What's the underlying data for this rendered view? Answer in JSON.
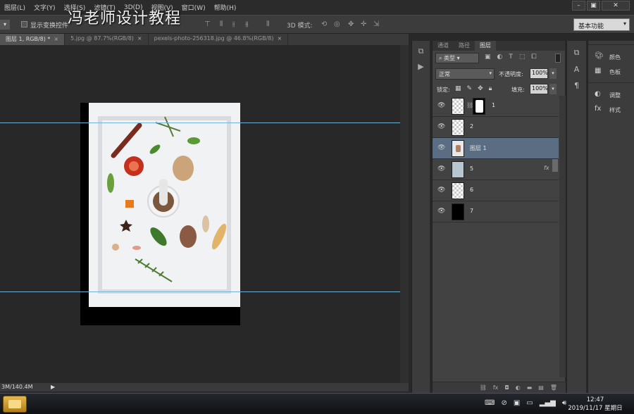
{
  "menubar": {
    "items": [
      "图层(L)",
      "文字(Y)",
      "选择(S)",
      "滤镜(T)",
      "3D(D)",
      "视图(V)",
      "窗口(W)",
      "帮助(H)"
    ],
    "watermark": "冯老师设计教程"
  },
  "options_bar": {
    "show_transform_label": "显示变换控件",
    "mode_3d_label": "3D 模式:",
    "workspace": "基本功能"
  },
  "doc_tabs": [
    {
      "label": "图层 1, RGB/8) *",
      "active": true
    },
    {
      "label": "5.jpg @ 87.7%(RGB/8)",
      "active": false
    },
    {
      "label": "pexels-photo-256318.jpg @ 46.8%(RGB/8)",
      "active": false
    }
  ],
  "statusbar": {
    "doc_size": "3M/140.4M"
  },
  "layers_panel": {
    "tabs": [
      "通道",
      "路径",
      "图层"
    ],
    "active_tab": "图层",
    "filter_label": "类型",
    "blend_mode": "正常",
    "opacity_label": "不透明度:",
    "opacity_value": "100%",
    "lock_label": "锁定:",
    "fill_label": "填充:",
    "fill_value": "100%",
    "layers": [
      {
        "name": "1",
        "thumb": "checker",
        "has_mask": true,
        "fx": false,
        "selected": false
      },
      {
        "name": "2",
        "thumb": "checker",
        "has_mask": false,
        "fx": false,
        "selected": false
      },
      {
        "name": "图层 1",
        "thumb": "photo",
        "has_mask": false,
        "fx": false,
        "selected": true
      },
      {
        "name": "5",
        "thumb": "blue",
        "has_mask": false,
        "fx": true,
        "selected": false
      },
      {
        "name": "6",
        "thumb": "checker",
        "has_mask": false,
        "fx": false,
        "selected": false
      },
      {
        "name": "7",
        "thumb": "black",
        "has_mask": false,
        "fx": false,
        "selected": false
      }
    ]
  },
  "right_panel": {
    "items": [
      {
        "label": "颜色",
        "icon": "palette-icon"
      },
      {
        "label": "色板",
        "icon": "swatches-icon"
      },
      {
        "label": "调整",
        "icon": "adjustments-icon"
      },
      {
        "label": "样式",
        "icon": "styles-icon"
      }
    ]
  },
  "taskbar": {
    "time": "12:47",
    "date": "2019/11/17 星期日"
  },
  "colors": {
    "guide": "#6fb3d9",
    "selected_layer": "#5a6d83",
    "canvas_bg": "#282828"
  }
}
